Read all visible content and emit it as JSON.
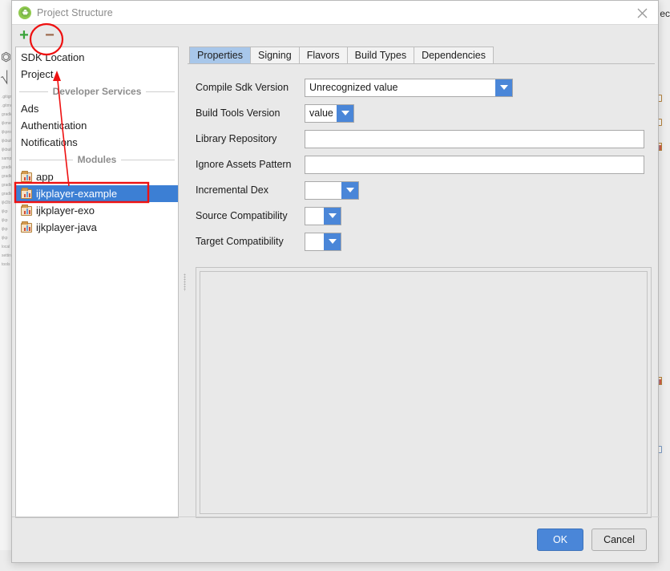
{
  "window": {
    "title": "Project Structure",
    "app_icon": "android-icon",
    "close_icon": "close-icon"
  },
  "toolbar": {
    "add_label": "+",
    "remove_label": "−",
    "add_icon": "plus-icon",
    "remove_icon": "minus-icon"
  },
  "sidebar": {
    "top_items": [
      {
        "label": "SDK Location"
      },
      {
        "label": "Project"
      }
    ],
    "sections": [
      {
        "title": "Developer Services",
        "items": [
          {
            "label": "Ads"
          },
          {
            "label": "Authentication"
          },
          {
            "label": "Notifications"
          }
        ]
      },
      {
        "title": "Modules",
        "items": [
          {
            "label": "app",
            "icon": "android-module-icon",
            "selected": false
          },
          {
            "label": "ijkplayer-example",
            "icon": "android-module-icon",
            "selected": true
          },
          {
            "label": "ijkplayer-exo",
            "icon": "android-module-icon",
            "selected": false
          },
          {
            "label": "ijkplayer-java",
            "icon": "android-module-icon",
            "selected": false
          }
        ]
      }
    ]
  },
  "tabs": [
    {
      "label": "Properties",
      "active": true
    },
    {
      "label": "Signing",
      "active": false
    },
    {
      "label": "Flavors",
      "active": false
    },
    {
      "label": "Build Types",
      "active": false
    },
    {
      "label": "Dependencies",
      "active": false
    }
  ],
  "form": {
    "compile_sdk_version": {
      "label": "Compile Sdk Version",
      "value": "Unrecognized value"
    },
    "build_tools_version": {
      "label": "Build Tools Version",
      "value": "value"
    },
    "library_repository": {
      "label": "Library Repository",
      "value": "",
      "placeholder": ""
    },
    "ignore_assets_pattern": {
      "label": "Ignore Assets Pattern",
      "value": "",
      "placeholder": ""
    },
    "incremental_dex": {
      "label": "Incremental Dex",
      "value": ""
    },
    "source_compatibility": {
      "label": "Source Compatibility",
      "value": ""
    },
    "target_compatibility": {
      "label": "Target Compatibility",
      "value": ""
    }
  },
  "footer": {
    "ok_label": "OK",
    "cancel_label": "Cancel"
  },
  "colors": {
    "accent_blue": "#4a86d8",
    "selection_blue": "#3c7fd4",
    "tab_active": "#a8c7ea",
    "annotation_red": "#ee1111",
    "plus_green": "#3aa33a",
    "dialog_bg": "#e9e9e9"
  },
  "annotations": {
    "remove_button_circle": "red-circle-highlight",
    "selected_module_box": "red-rectangle-highlight",
    "pointer_arrow": "red-arrow"
  },
  "background": {
    "left_tree_lines": [
      ".gitignore",
      ".gitmodules",
      "gradle",
      "ijkmedia",
      "ijkprof",
      "ijkbuild",
      "ijkbuild",
      "sample",
      "gradle",
      "gradle",
      "gradle",
      "gradle",
      "ijkDb",
      "ijkp",
      "ijkp",
      "ijkp",
      "ijkp",
      "local",
      "settin",
      "tools"
    ],
    "right_edge_text": "ec"
  }
}
